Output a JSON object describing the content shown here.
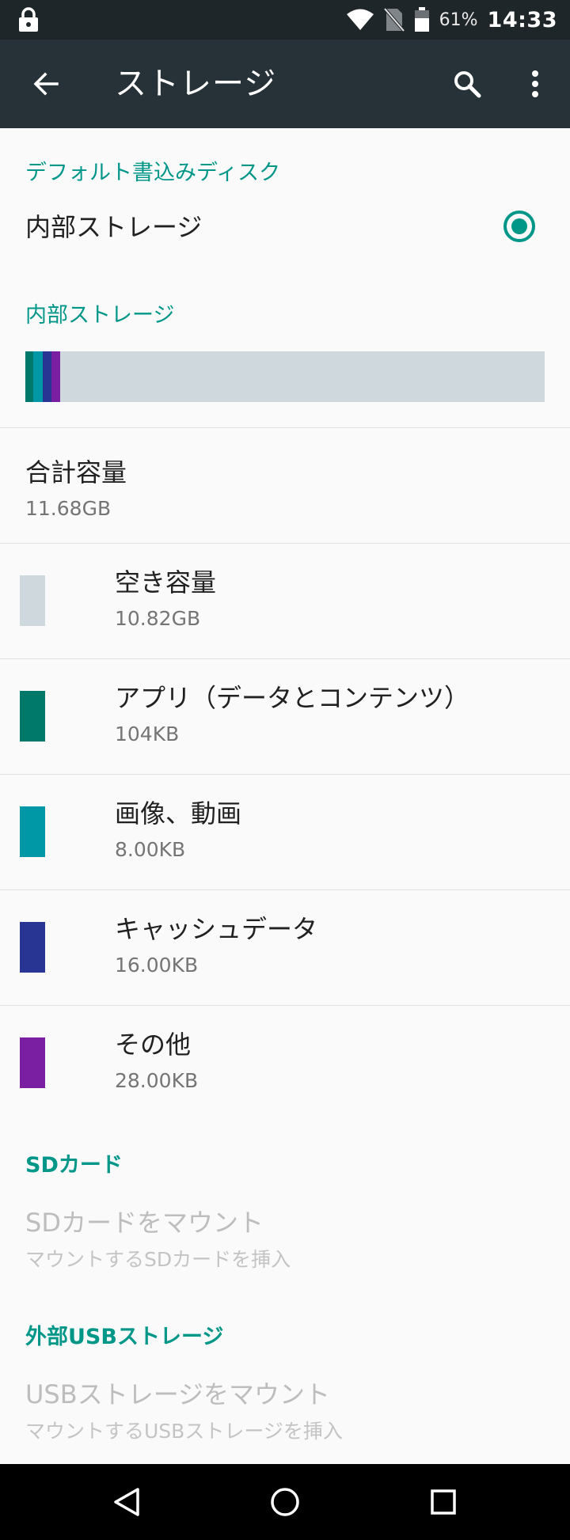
{
  "status_bar": {
    "battery_percent": "61%",
    "time": "14:33",
    "icons": [
      "lock-icon",
      "wifi-icon",
      "no-sim-icon",
      "battery-icon"
    ]
  },
  "toolbar": {
    "title": "ストレージ",
    "icons": [
      "back-arrow-icon",
      "search-icon",
      "more-vert-icon"
    ]
  },
  "default_write_disk": {
    "header": "デフォルト書込みディスク",
    "option_label": "内部ストレージ",
    "selected": true
  },
  "internal_storage": {
    "header": "内部ストレージ",
    "usage_segments": [
      {
        "name": "apps",
        "color": "#00796b",
        "fraction": 0.016
      },
      {
        "name": "images",
        "color": "#0097a7",
        "fraction": 0.017
      },
      {
        "name": "cache",
        "color": "#283593",
        "fraction": 0.017
      },
      {
        "name": "other",
        "color": "#7b1fa2",
        "fraction": 0.017
      }
    ],
    "bar_background": "#cfd8dc",
    "total_label": "合計容量",
    "total_value": "11.68GB",
    "categories": [
      {
        "label": "空き容量",
        "value": "10.82GB",
        "color": "#cfd8dc"
      },
      {
        "label": "アプリ（データとコンテンツ）",
        "value": "104KB",
        "color": "#00796b"
      },
      {
        "label": "画像、動画",
        "value": "8.00KB",
        "color": "#0097a7"
      },
      {
        "label": "キャッシュデータ",
        "value": "16.00KB",
        "color": "#283593"
      },
      {
        "label": "その他",
        "value": "28.00KB",
        "color": "#7b1fa2"
      }
    ]
  },
  "sd_card": {
    "header": "SDカード",
    "title": "SDカードをマウント",
    "subtitle": "マウントするSDカードを挿入"
  },
  "usb_storage": {
    "header": "外部USBストレージ",
    "title": "USBストレージをマウント",
    "subtitle": "マウントするUSBストレージを挿入"
  },
  "nav_bar": {
    "icons": [
      "nav-back-icon",
      "nav-home-icon",
      "nav-recents-icon"
    ]
  }
}
